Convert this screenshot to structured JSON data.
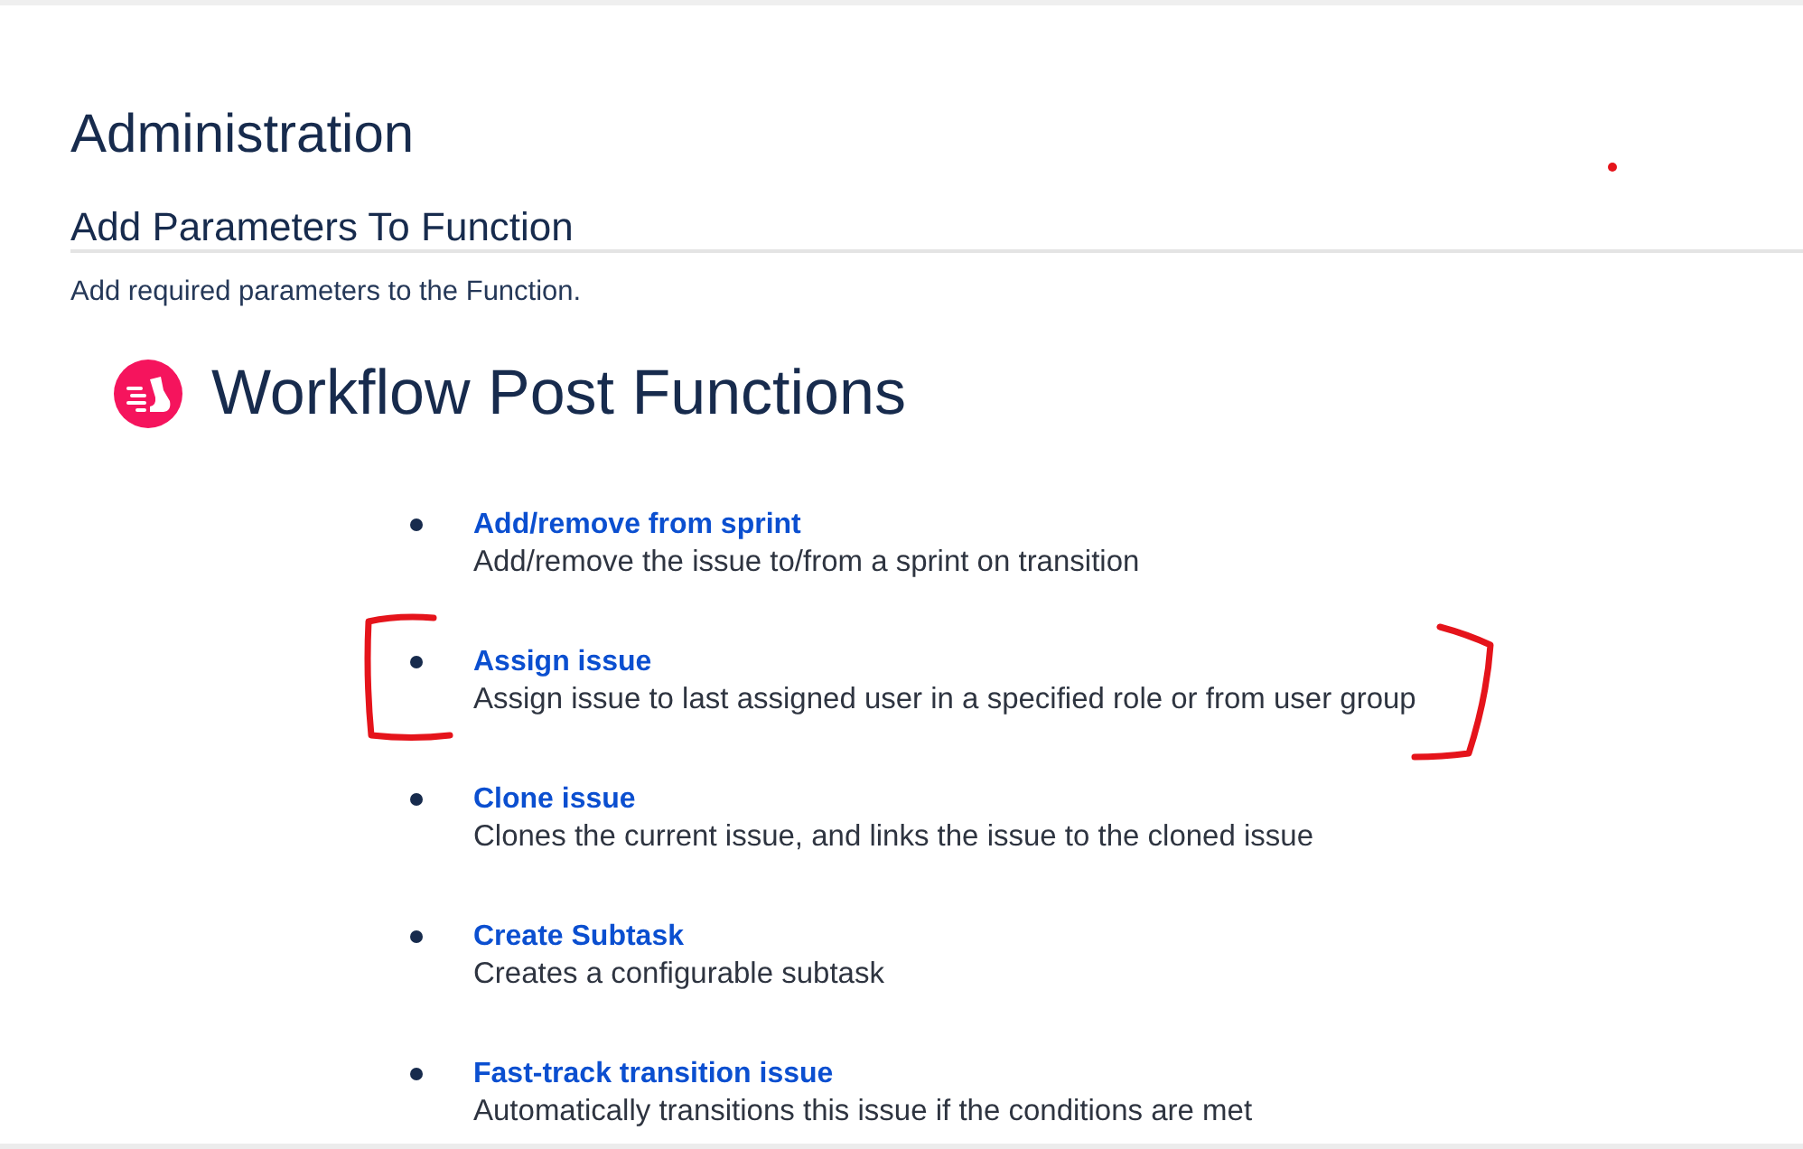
{
  "page": {
    "title": "Administration"
  },
  "section": {
    "title": "Add Parameters To Function",
    "description": "Add required parameters to the Function."
  },
  "app_header": {
    "title": "Workflow Post Functions"
  },
  "functions": [
    {
      "name": "Add/remove from sprint",
      "description": "Add/remove the issue to/from a sprint on transition",
      "highlighted": false
    },
    {
      "name": "Assign issue",
      "description": "Assign issue to last assigned user in a specified role or from user group",
      "highlighted": true
    },
    {
      "name": "Clone issue",
      "description": "Clones the current issue, and links the issue to the cloned issue",
      "highlighted": false
    },
    {
      "name": "Create Subtask",
      "description": "Creates a configurable subtask",
      "highlighted": false
    },
    {
      "name": "Fast-track transition issue",
      "description": "Automatically transitions this issue if the conditions are met",
      "highlighted": false
    }
  ],
  "annotations": {
    "dot": true
  }
}
